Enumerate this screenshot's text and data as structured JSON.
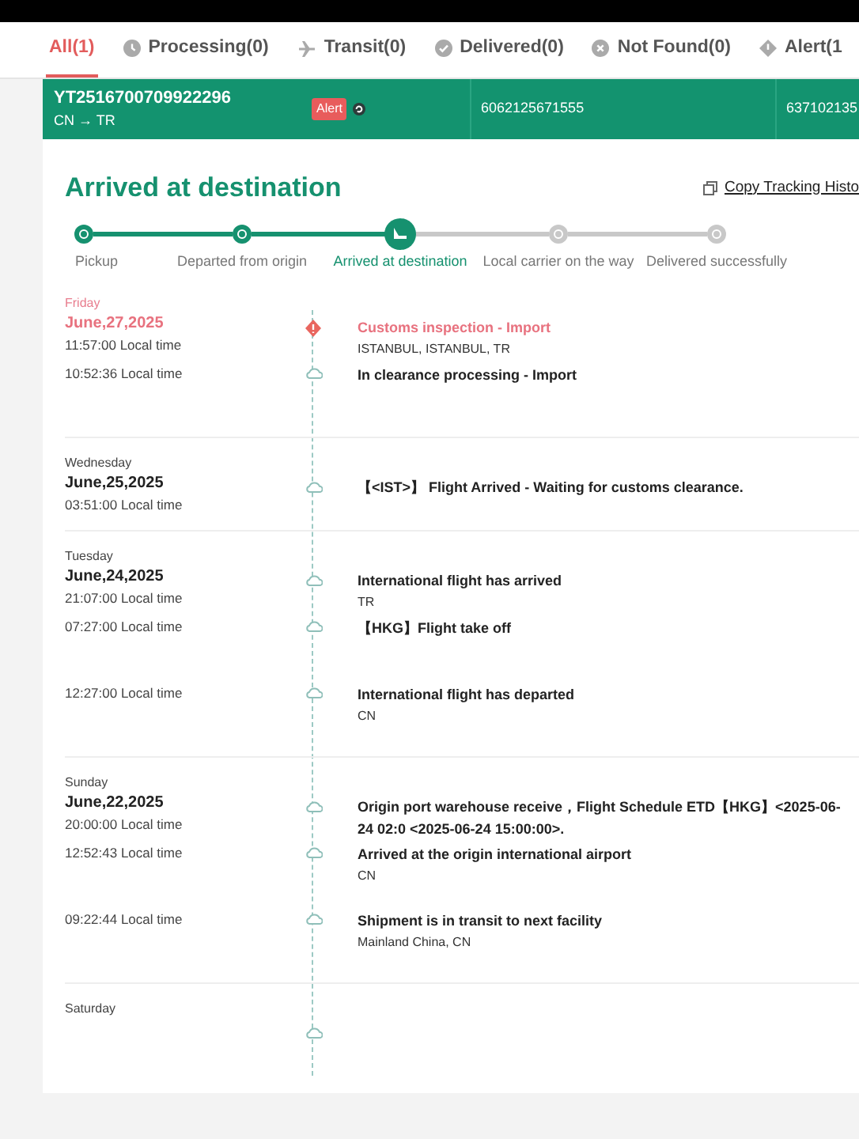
{
  "tabs": [
    {
      "label": "All(1)",
      "selected": true
    },
    {
      "label": "Processing(0)",
      "selected": false
    },
    {
      "label": "Transit(0)",
      "selected": false
    },
    {
      "label": "Delivered(0)",
      "selected": false
    },
    {
      "label": "Not Found(0)",
      "selected": false
    },
    {
      "label": "Alert(1",
      "selected": false
    }
  ],
  "shipment": {
    "tracking_number": "YT2516700709922296",
    "route": "CN → TR",
    "status_badge": "Alert",
    "column_3": "6062125671555",
    "column_4": "637102135",
    "selected": true
  },
  "status_title": "Arrived at destination",
  "copy_link": "Copy Tracking Histo",
  "milestones": [
    {
      "label": "Pickup",
      "completed": true,
      "selected": false
    },
    {
      "label": "Departed from origin",
      "completed": true,
      "selected": false
    },
    {
      "label": "Arrived at destination",
      "completed": true,
      "selected": true
    },
    {
      "label": "Local carrier on the way",
      "completed": false,
      "selected": false
    },
    {
      "label": "Delivered successfully",
      "completed": false,
      "selected": false
    }
  ],
  "days": [
    {
      "weekday": "Friday",
      "date": "June,27,2025",
      "alert": true,
      "events": [
        {
          "time": "11:57:00 Local time",
          "title": "Customs inspection - Import",
          "location": "ISTANBUL, ISTANBUL, TR",
          "kind": "alert"
        },
        {
          "time": "10:52:36 Local time",
          "title": "In clearance processing - Import",
          "kind": "normal"
        }
      ]
    },
    {
      "weekday": "Wednesday",
      "date": "June,25,2025",
      "alert": false,
      "events": [
        {
          "time": "03:51:00 Local time",
          "title": "【<IST>】 Flight Arrived - Waiting for customs clearance.",
          "kind": "normal"
        }
      ]
    },
    {
      "weekday": "Tuesday",
      "date": "June,24,2025",
      "alert": false,
      "events": [
        {
          "time": "21:07:00 Local time",
          "title": "International flight has arrived",
          "location": "TR",
          "kind": "normal"
        },
        {
          "time": "07:27:00 Local time",
          "title": "【HKG】Flight take off",
          "kind": "normal"
        },
        {
          "time": "12:27:00 Local time",
          "title": "International flight has departed",
          "location": "CN",
          "kind": "normal"
        }
      ]
    },
    {
      "weekday": "Sunday",
      "date": "June,22,2025",
      "alert": false,
      "events": [
        {
          "time": "20:00:00 Local time",
          "title": "Origin port warehouse receive，Flight Schedule ETD【HKG】<2025-06-24 02:0 <2025-06-24 15:00:00>.",
          "kind": "normal"
        },
        {
          "time": "12:52:43 Local time",
          "title": "Arrived at the origin international airport",
          "location": "CN",
          "kind": "normal"
        },
        {
          "time": "09:22:44 Local time",
          "title": "Shipment is in transit to next facility",
          "location": "Mainland China, CN",
          "kind": "normal"
        }
      ]
    },
    {
      "weekday": "Saturday",
      "alert": false,
      "events": [
        {
          "kind": "normal"
        }
      ]
    }
  ]
}
